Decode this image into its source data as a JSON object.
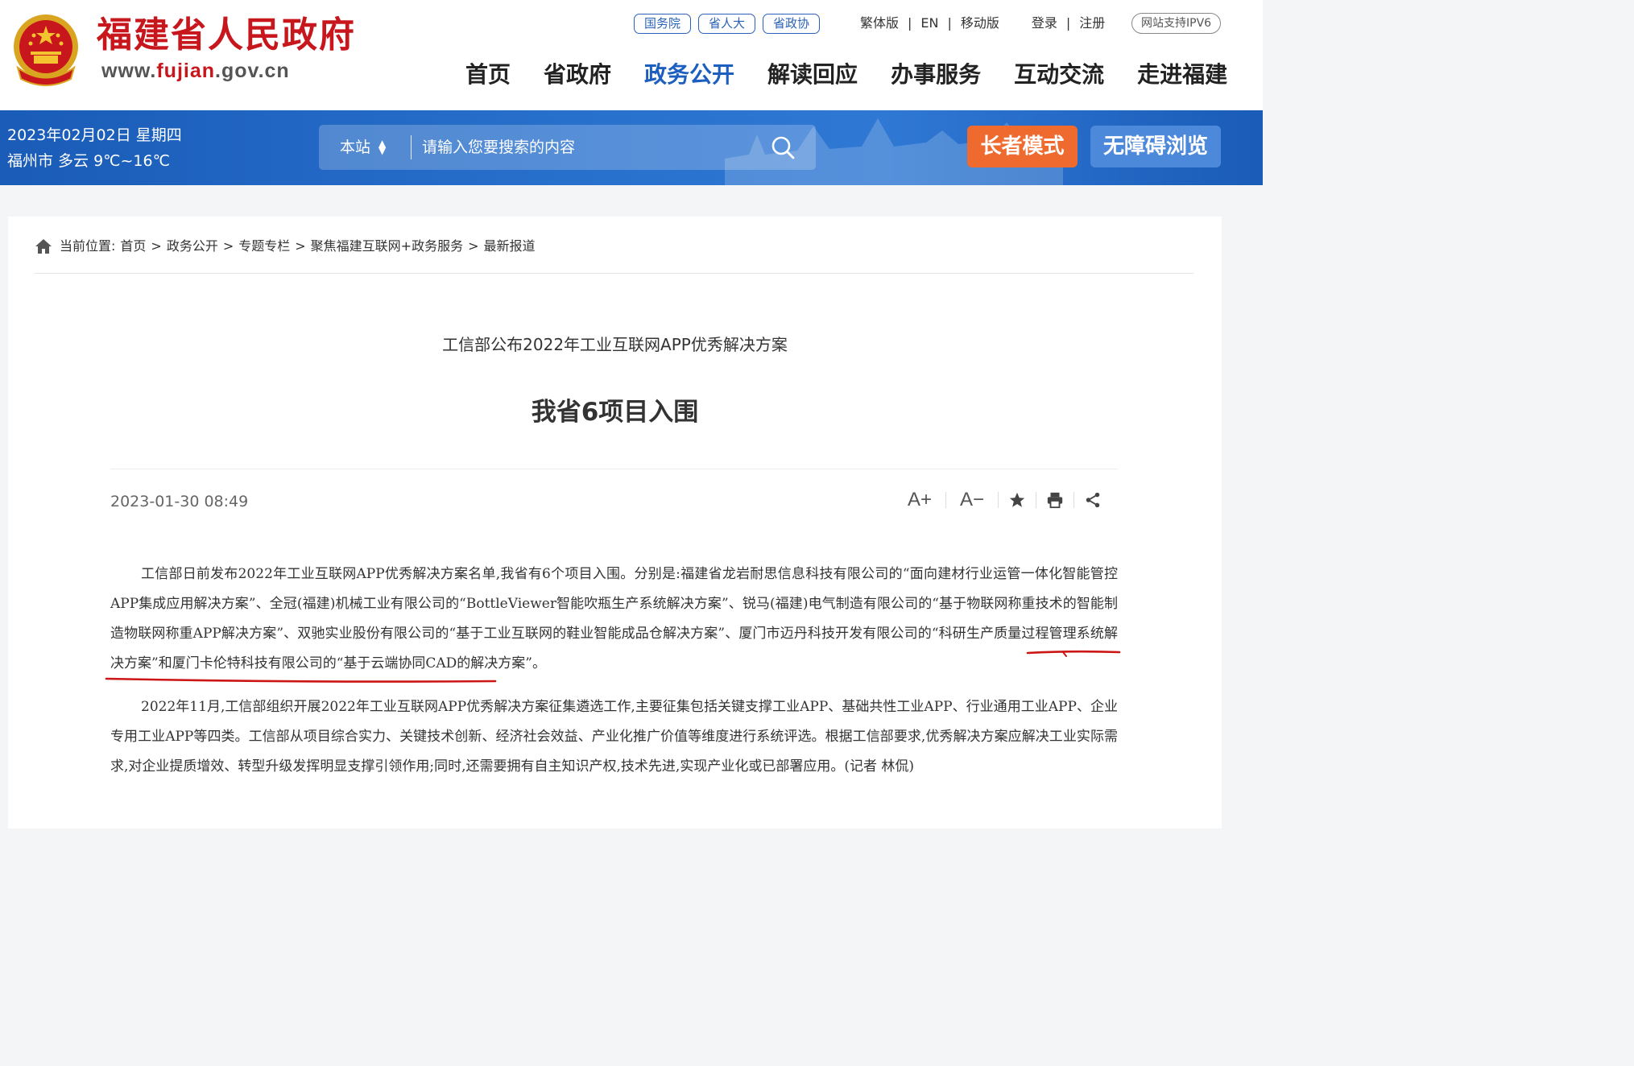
{
  "header": {
    "site_name": "福建省人民政府",
    "site_url_prefix": "www.",
    "site_url_highlight": "fujian",
    "site_url_suffix": ".gov.cn",
    "pills": [
      "国务院",
      "省人大",
      "省政协"
    ],
    "links": [
      "繁体版",
      "EN",
      "移动版"
    ],
    "auth": [
      "登录",
      "注册"
    ],
    "ipv6_badge": "网站支持IPV6",
    "nav": [
      "首页",
      "省政府",
      "政务公开",
      "解读回应",
      "办事服务",
      "互动交流",
      "走进福建"
    ],
    "nav_active_index": 2
  },
  "banner": {
    "date": "2023年02月02日 星期四",
    "weather": "福州市 多云 9℃~16℃",
    "search_scope": "本站",
    "search_placeholder": "请输入您要搜索的内容",
    "elder_mode": "长者模式",
    "accessibility": "无障碍浏览"
  },
  "breadcrumb": {
    "label": "当前位置:",
    "items": [
      "首页",
      "政务公开",
      "专题专栏",
      "聚焦福建互联网+政务服务",
      "最新报道"
    ],
    "separator": ">"
  },
  "article": {
    "subtitle": "工信部公布2022年工业互联网APP优秀解决方案",
    "title": "我省6项目入围",
    "published": "2023-01-30 08:49",
    "tools": {
      "font_increase": "A+",
      "font_decrease": "A−"
    },
    "paragraphs": [
      "工信部日前发布2022年工业互联网APP优秀解决方案名单,我省有6个项目入围。分别是:福建省龙岩耐思信息科技有限公司的“面向建材行业运管一体化智能管控APP集成应用解决方案”、全冠(福建)机械工业有限公司的“BottleViewer智能吹瓶生产系统解决方案”、锐马(福建)电气制造有限公司的“基于物联网称重技术的智能制造物联网称重APP解决方案”、双驰实业股份有限公司的“基于工业互联网的鞋业智能成品仓解决方案”、厦门市迈丹科技开发有限公司的“科研生产质量过程管理系统解决方案”和厦门卡伦特科技有限公司的“基于云端协同CAD的解决方案”。",
      "2022年11月,工信部组织开展2022年工业互联网APP优秀解决方案征集遴选工作,主要征集包括关键支撑工业APP、基础共性工业APP、行业通用工业APP、企业专用工业APP等四类。工信部从项目综合实力、关键技术创新、经济社会效益、产业化推广价值等维度进行系统评选。根据工信部要求,优秀解决方案应解决工业实际需求,对企业提质增效、转型升级发挥明显支撑引领作用;同时,还需要拥有自主知识产权,技术先进,实现产业化或已部署应用。(记者 林侃)"
    ]
  },
  "colors": {
    "brand_red": "#c8161d",
    "nav_active": "#1d5fbf",
    "banner_blue": "#2770cc",
    "elder_orange": "#ee6a2f",
    "access_blue": "#4d89da",
    "ink_red": "#cc1515"
  }
}
